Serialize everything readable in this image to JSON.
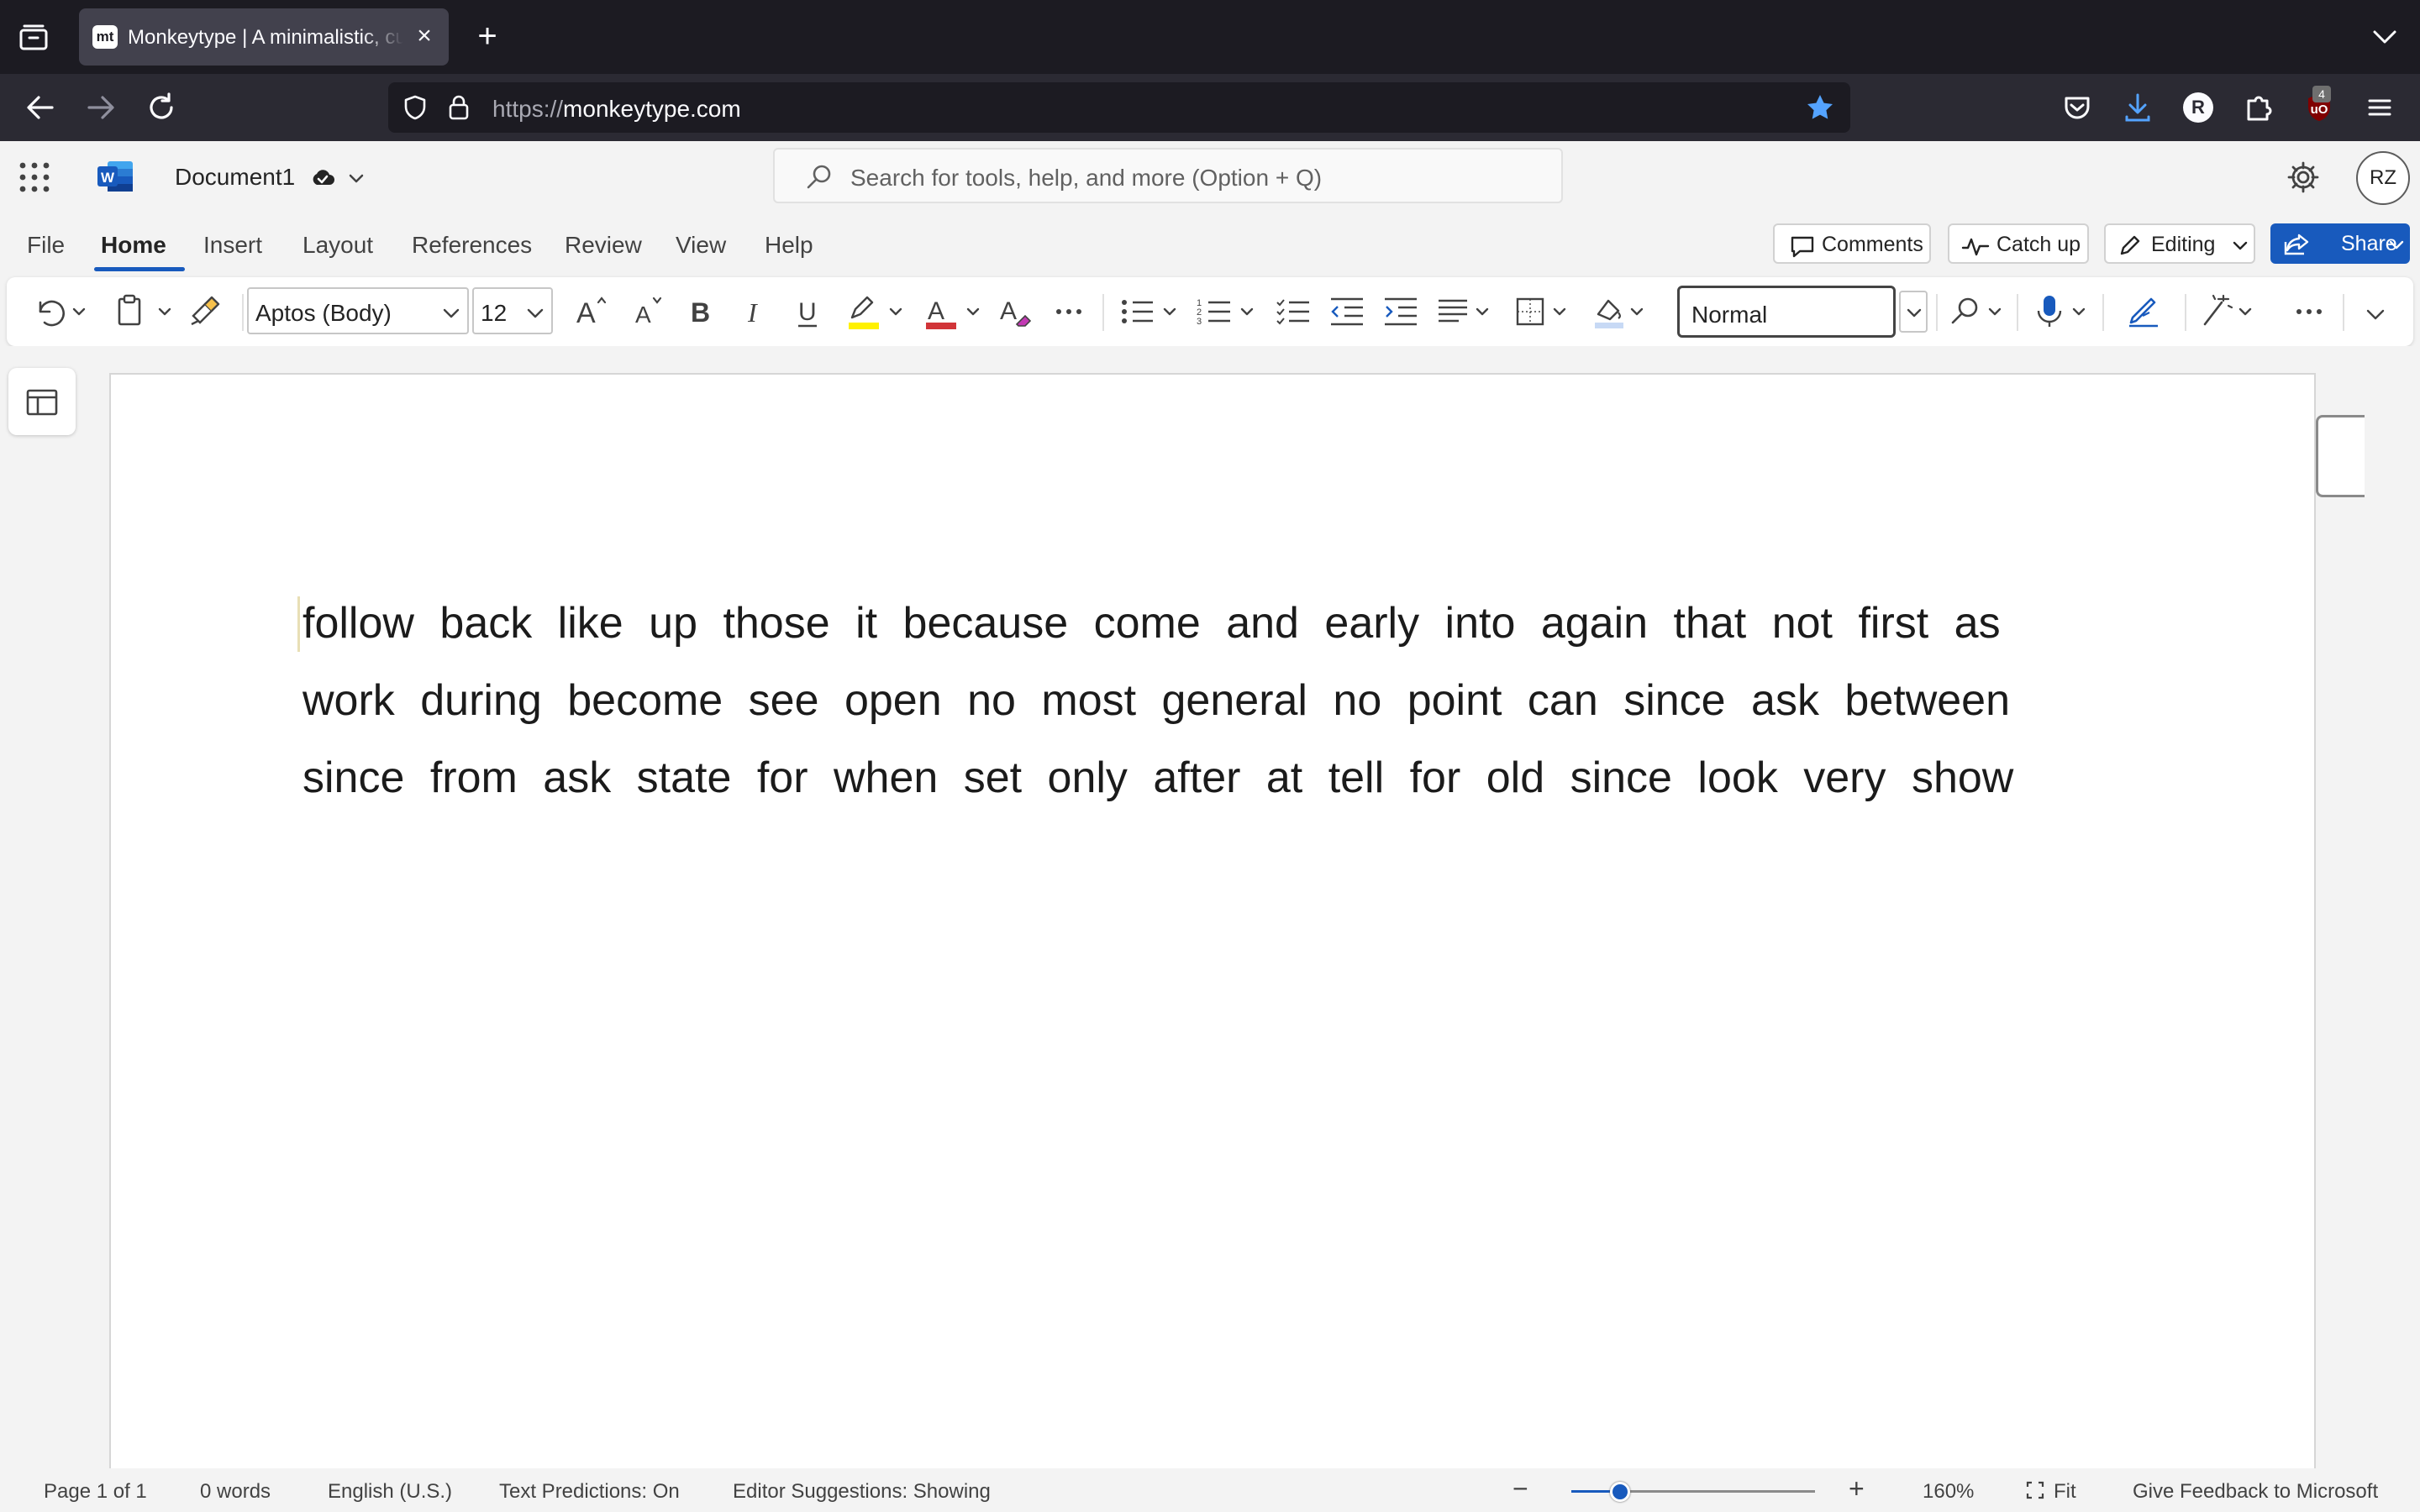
{
  "browser": {
    "tab_title": "Monkeytype | A minimalistic, customizable typing test",
    "tab_favicon": "mt",
    "url_scheme": "https://",
    "url_host": "monkeytype.com",
    "profile_initial": "R",
    "extension_badge": "4"
  },
  "app": {
    "doc_name": "Document1",
    "search_placeholder": "Search for tools, help, and more (Option + Q)",
    "avatar_initials": "RZ"
  },
  "ribbon_tabs": [
    "File",
    "Home",
    "Insert",
    "Layout",
    "References",
    "Review",
    "View",
    "Help"
  ],
  "actions": {
    "comments": "Comments",
    "catch_up": "Catch up",
    "editing": "Editing",
    "share": "Share"
  },
  "toolbar": {
    "font_name": "Aptos (Body)",
    "font_size": "12",
    "style": "Normal",
    "bold": "B",
    "italic": "I",
    "underline": "U"
  },
  "document": {
    "text": "follow back like up those it because come and early into again that not first as work during become see open no most general no point can since ask between since from ask state for when set only after at tell for old since look very show"
  },
  "status": {
    "page": "Page 1 of 1",
    "words": "0 words",
    "language": "English (U.S.)",
    "predictions": "Text Predictions: On",
    "editor": "Editor Suggestions: Showing",
    "zoom_level": "160%",
    "zoom_fraction": 0.2,
    "fit": "Fit",
    "feedback": "Give Feedback to Microsoft"
  },
  "colors": {
    "accent": "#185abd",
    "highlight": "#fff100",
    "font_color": "#d13438",
    "star": "#54a3ff"
  }
}
